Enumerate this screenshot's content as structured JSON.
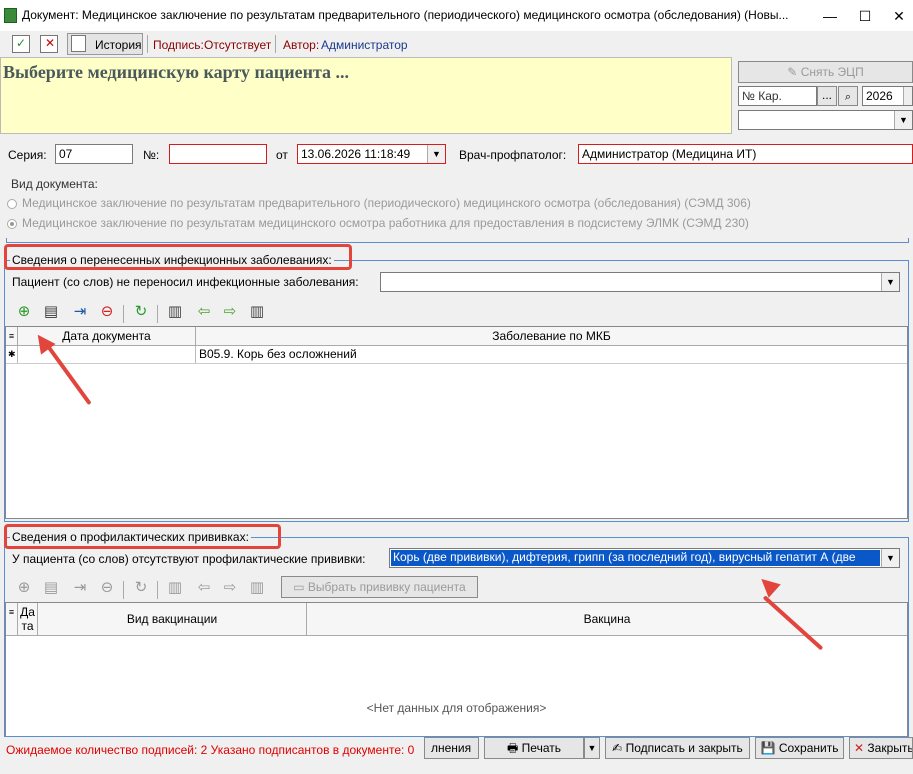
{
  "window": {
    "title": "Документ: Медицинское заключение по результатам предварительного (периодического) медицинского осмотра (обследования) (Новы...",
    "minimize": "—",
    "maximize": "☐",
    "close": "✕"
  },
  "toolbar": {
    "history_label": "История",
    "signature_label": "Подпись:",
    "signature_value": "Отсутствует",
    "author_label": "Автор:",
    "author_value": "Администратор"
  },
  "header": {
    "prompt": "Выберите медицинскую карту пациента ...",
    "remove_signature_label": "Снять ЭЦП",
    "card_placeholder": "№ Кар.",
    "card_browse": "...",
    "year_value": "2026"
  },
  "doc_fields": {
    "series_label": "Серия:",
    "series_value": "07",
    "number_label": "№:",
    "number_value": "",
    "from_label": "от",
    "date_value": "13.06.2026 11:18:49",
    "doctor_label": "Врач-профпатолог:",
    "doctor_value": "Администратор (Медицина ИТ)"
  },
  "doc_type": {
    "label": "Вид документа:",
    "option1": "Медицинское заключение по результатам предварительного (периодического) медицинского осмотра (обследования) (СЭМД 306)",
    "option2": "Медицинское заключение по результатам медицинского осмотра работника для предоставления в подсистему ЭЛМК (СЭМД 230)"
  },
  "infections": {
    "group_title": "Сведения о перенесенных инфекционных заболеваниях:",
    "patient_label": "Пациент (со слов) не переносил инфекционные заболевания:",
    "patient_value": "",
    "columns": [
      "Дата документа",
      "Заболевание по МКБ"
    ],
    "rows": [
      {
        "date": "",
        "disease": "B05.9. Корь без осложнений"
      }
    ]
  },
  "vaccinations": {
    "group_title": "Сведения о профилактических прививках:",
    "patient_label": "У пациента (со слов) отсутствуют профилактические прививки:",
    "patient_value": "Корь (две прививки), дифтерия, грипп (за последний год), вирусный гепатит А (две",
    "select_button": "Выбрать прививку пациента",
    "columns": [
      "Дата",
      "Вид вакцинации",
      "Вакцина"
    ],
    "empty_text": "<Нет данных для отображения>"
  },
  "status_bar": {
    "signatures_text": "Ожидаемое количество подписей: 2 Указано подписантов в документе: 0",
    "btn_fill": "лнения",
    "btn_print": "Печать",
    "btn_sign_close": "Подписать и закрыть",
    "btn_save": "Сохранить",
    "btn_close": "Закрыть"
  },
  "colors": {
    "highlight": "#e2453c",
    "required_border": "#d21e1e",
    "prompt_bg": "#ffffc8",
    "status_text": "#e00000"
  }
}
